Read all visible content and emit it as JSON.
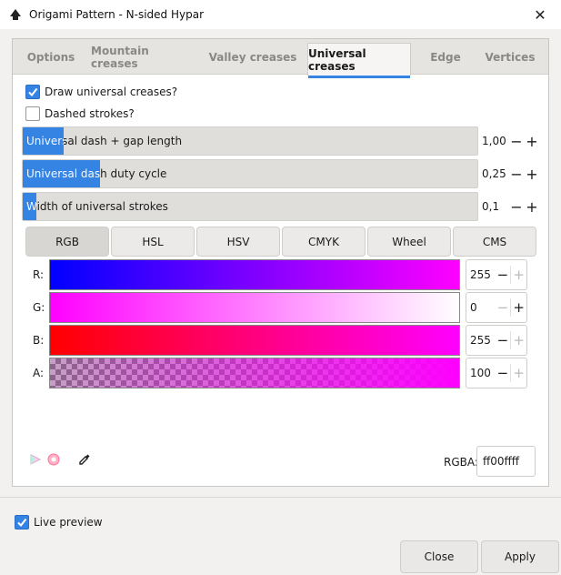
{
  "window": {
    "title": "Origami Pattern - N-sided Hypar",
    "close_glyph": "✕"
  },
  "tabs": [
    {
      "label": "Options"
    },
    {
      "label": "Mountain creases"
    },
    {
      "label": "Valley creases"
    },
    {
      "label": "Universal creases",
      "active": true
    },
    {
      "label": "Edge"
    },
    {
      "label": "Vertices"
    }
  ],
  "checkboxes": {
    "draw_universal": {
      "label": "Draw universal creases?",
      "checked": true
    },
    "dashed": {
      "label": "Dashed strokes?",
      "checked": false
    }
  },
  "sliders": [
    {
      "label": "Universal dash + gap length",
      "value": "1,00",
      "fill_fraction": 0.09
    },
    {
      "label": "Universal dash duty cycle",
      "value": "0,25",
      "fill_fraction": 0.17
    },
    {
      "label": "Width of universal strokes",
      "value": "0,1",
      "fill_fraction": 0.03
    }
  ],
  "slider_buttons": {
    "minus": "−",
    "plus": "+"
  },
  "color_modes": [
    {
      "label": "RGB",
      "active": true
    },
    {
      "label": "HSL"
    },
    {
      "label": "HSV"
    },
    {
      "label": "CMYK"
    },
    {
      "label": "Wheel"
    },
    {
      "label": "CMS"
    }
  ],
  "channels": [
    {
      "label": "R:",
      "value": "255",
      "minus_enabled": true,
      "plus_enabled": false
    },
    {
      "label": "G:",
      "value": "0",
      "minus_enabled": false,
      "plus_enabled": true
    },
    {
      "label": "B:",
      "value": "255",
      "minus_enabled": true,
      "plus_enabled": false
    },
    {
      "label": "A:",
      "value": "100",
      "minus_enabled": true,
      "plus_enabled": false
    }
  ],
  "colors": {
    "accent": "#3584e4",
    "current": "#ff00ff"
  },
  "icons": [
    "color-managed-icon",
    "out-of-gamut-icon",
    "eyedropper-icon"
  ],
  "rgba": {
    "label": "RGBA:",
    "value": "ff00ffff"
  },
  "live_preview": {
    "label": "Live preview",
    "checked": true
  },
  "footer": {
    "close_label": "Close",
    "apply_label": "Apply"
  }
}
